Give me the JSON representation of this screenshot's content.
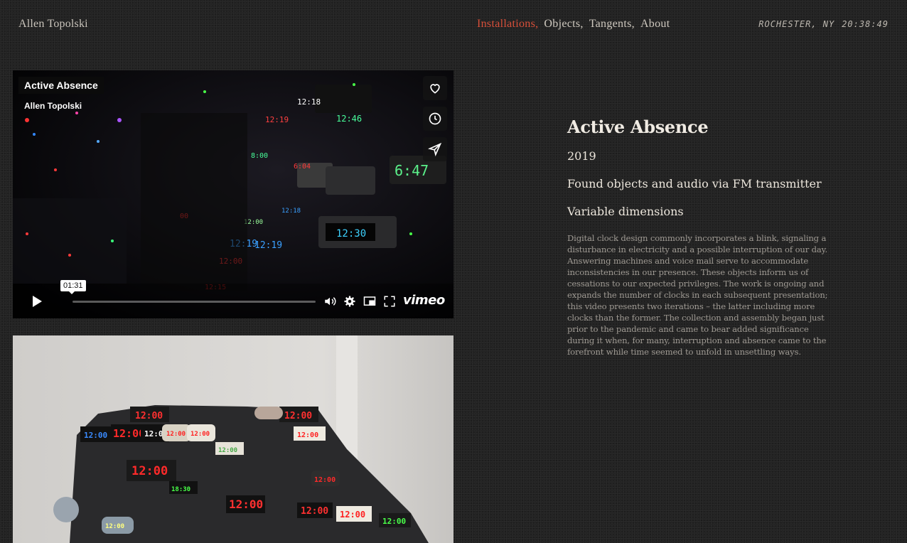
{
  "header": {
    "site_name": "Allen Topolski",
    "nav": [
      {
        "label": "Installations,",
        "active": true
      },
      {
        "label": "Objects,",
        "active": false
      },
      {
        "label": "Tangents,",
        "active": false
      },
      {
        "label": "About",
        "active": false
      }
    ],
    "location": "ROCHESTER, NY",
    "clock": "20:38:49"
  },
  "player": {
    "title": "Active Absence",
    "author": "Allen Topolski",
    "time_tooltip": "01:31",
    "brand": "vimeo",
    "progress": 0,
    "side_icons": [
      "heart-icon",
      "clock-icon",
      "send-icon"
    ],
    "control_icons": [
      "play-icon",
      "volume-icon",
      "settings-icon",
      "pip-icon",
      "fullscreen-icon"
    ]
  },
  "work": {
    "title": "Active Absence",
    "year": "2019",
    "medium": "Found objects and audio via FM transmitter",
    "dimensions": "Variable dimensions",
    "description": "Digital clock design commonly incorporates a blink, signaling a disturbance in electricity and a possible interruption of our day. Answering machines and voice mail serve to accommodate inconsistencies in our presence. These objects inform us of cessations to our expected privileges. The work is ongoing and expands the number of clocks in each subsequent presentation; this video presents two iterations – the latter including more clocks than the former. The collection and assembly began just prior to the pandemic and came to bear added significance during it when, for many, interruption and absence came to the forefront while time seemed to unfold in unsettling ways."
  },
  "colors": {
    "accent": "#d9503a",
    "background": "#232323"
  }
}
